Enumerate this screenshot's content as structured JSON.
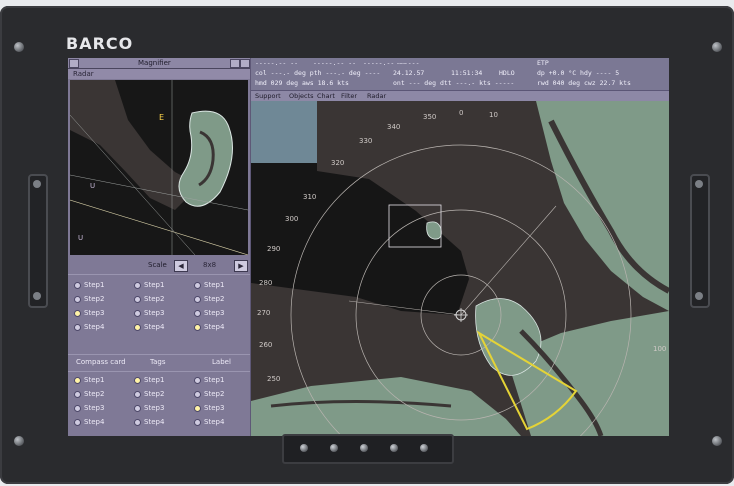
{
  "brand": {
    "logo_text": "BARCO"
  },
  "magnifier": {
    "title": "Magnifier",
    "radar_label": "Radar",
    "scale_label": "Scale",
    "scale_value": "8x8",
    "left_arrow": "◀",
    "right_arrow": "▶"
  },
  "options_top": [
    {
      "items": [
        "Step1",
        "Step2",
        "Step3",
        "Step4"
      ],
      "selected_index": 2
    },
    {
      "items": [
        "Step1",
        "Step2",
        "Step3",
        "Step4"
      ],
      "selected_index": 3
    },
    {
      "items": [
        "Step1",
        "Step2",
        "Step3",
        "Step4"
      ],
      "selected_index": 3
    }
  ],
  "options_bottom_headers": [
    "Compass card",
    "Tags",
    "Label"
  ],
  "options_bottom": [
    {
      "items": [
        "Step1",
        "Step2",
        "Step3",
        "Step4"
      ],
      "selected_index": 0
    },
    {
      "items": [
        "Step1",
        "Step2",
        "Step3",
        "Step4"
      ],
      "selected_index": 0
    },
    {
      "items": [
        "Step1",
        "Step2",
        "Step3",
        "Step4"
      ],
      "selected_index": 2
    }
  ],
  "info_panel": {
    "row1": [
      "-----.-- --",
      "-----.-- --",
      "-----.-- --",
      "------",
      "ETP"
    ],
    "row2": [
      "col ---.- deg pth ---.- deg ----",
      "24.12.57",
      "11:51:34",
      "HDLO",
      "dp +0.0 °C hdy ---- 5"
    ],
    "row3": [
      "hmd 029 deg aws 18.6 kts",
      "ont --- deg dtt ---.- kts -----",
      "rwd 040 deg cwz 22.7 kts"
    ]
  },
  "menu": [
    "Support",
    "Objects",
    "Chart",
    "Filter",
    "Radar"
  ],
  "radar": {
    "bearing_labels": [
      "350",
      "0",
      "10",
      "340",
      "330",
      "320",
      "310",
      "300",
      "290",
      "280",
      "270",
      "260",
      "250",
      "100"
    ],
    "accent_colors": {
      "land": "#7f9a88",
      "water": "#3a3534",
      "sector": "#e4d337",
      "range_ring": "#b9b4b0"
    }
  }
}
